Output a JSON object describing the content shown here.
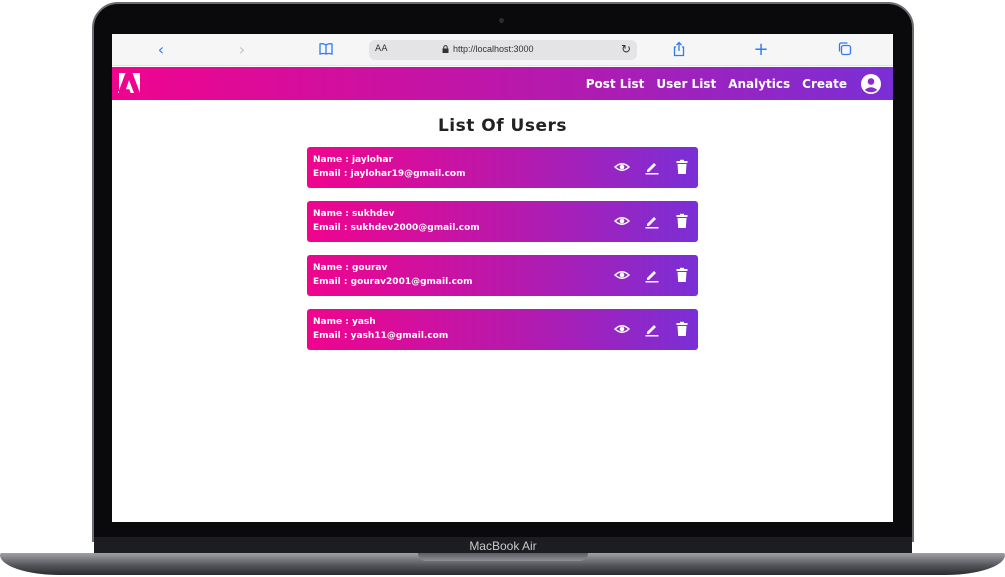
{
  "device": {
    "label": "MacBook Air"
  },
  "browser": {
    "reader_label": "AA",
    "url": "http://localhost:3000"
  },
  "navbar": {
    "links": [
      "Post List",
      "User List",
      "Analytics",
      "Create"
    ]
  },
  "page": {
    "title": "List Of Users"
  },
  "users": [
    {
      "name": "Name : jaylohar",
      "email": "Email : jaylohar19@gmail.com"
    },
    {
      "name": "Name : sukhdev",
      "email": "Email : sukhdev2000@gmail.com"
    },
    {
      "name": "Name : gourav",
      "email": "Email : gourav2001@gmail.com"
    },
    {
      "name": "Name : yash",
      "email": "Email : yash11@gmail.com"
    }
  ],
  "colors": {
    "gradient_start": "#f0048e",
    "gradient_end": "#7a2fd6",
    "browser_accent": "#2f7cf6"
  },
  "icons": {
    "browser": [
      "back-icon",
      "forward-icon",
      "bookmarks-icon",
      "lock-icon",
      "reload-icon",
      "share-icon",
      "new-tab-icon",
      "tabs-icon"
    ],
    "row_actions": [
      "eye-icon",
      "pencil-icon",
      "trash-icon"
    ],
    "navbar": [
      "adobe-logo-icon",
      "account-circle-icon"
    ]
  }
}
